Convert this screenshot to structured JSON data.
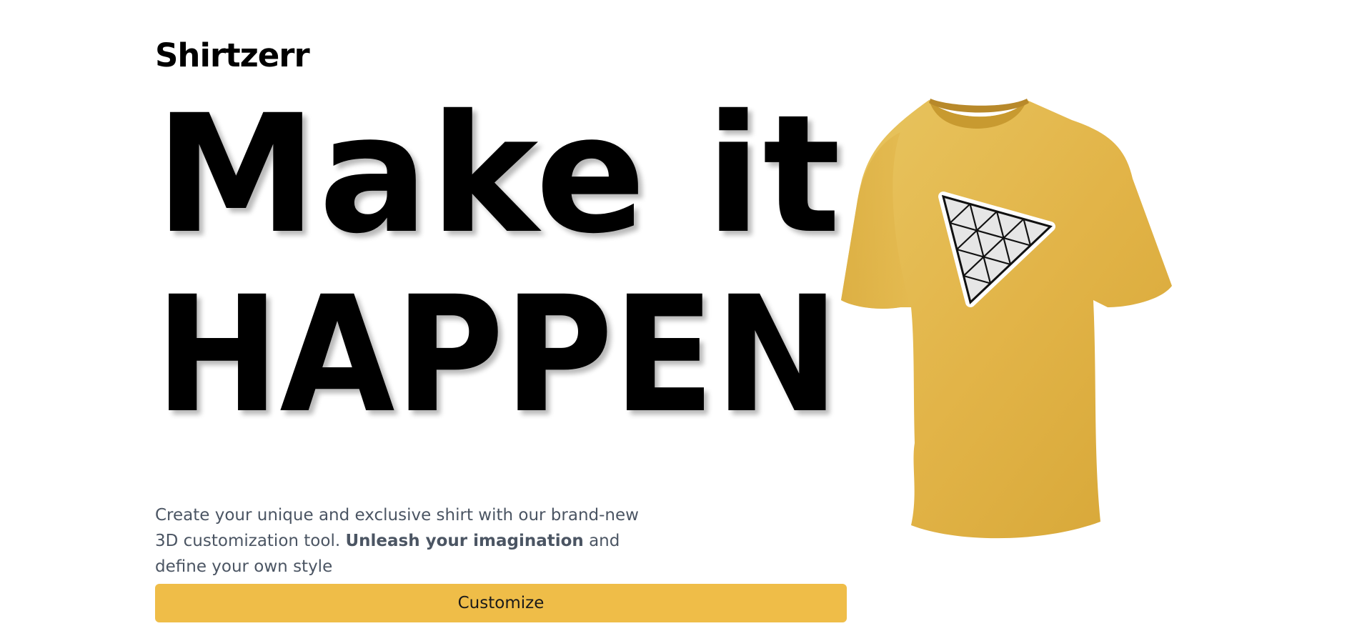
{
  "brand": {
    "name": "Shirtzerr"
  },
  "hero": {
    "headline_line1": "Make it",
    "headline_line2": "HAPPEN",
    "description_part1": "Create your unique and exclusive shirt with our brand-new 3D customization tool. ",
    "description_bold": "Unleash your imagination",
    "description_part2": " and define your own style",
    "cta_label": "Customize"
  },
  "shirt": {
    "icon": "tshirt-icon",
    "logo_icon": "triangle-logo-icon",
    "color": "#e2b448"
  },
  "colors": {
    "accent": "#efbd48",
    "text": "#000000",
    "muted_text": "#4b5563"
  }
}
